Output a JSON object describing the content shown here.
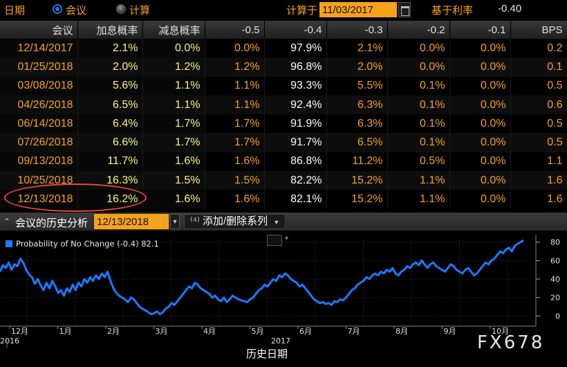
{
  "topbar": {
    "date_label": "日期",
    "mode_meeting": "会议",
    "mode_calc": "计算",
    "calc_label": "计算于",
    "calc_date": "11/03/2017",
    "base_rate_label": "基于利率",
    "base_rate_value": "-0.40"
  },
  "table": {
    "headers": [
      "会议",
      "加息概率",
      "减息概率",
      "-0.5",
      "-0.4",
      "-0.3",
      "-0.2",
      "-0.1",
      "BPS"
    ],
    "rows": [
      [
        "12/14/2017",
        "2.1%",
        "0.0%",
        "0.0%",
        "97.9%",
        "2.1%",
        "0.0%",
        "0.0%",
        "0.2"
      ],
      [
        "01/25/2018",
        "2.0%",
        "1.2%",
        "1.2%",
        "96.8%",
        "2.0%",
        "0.0%",
        "0.0%",
        "0.1"
      ],
      [
        "03/08/2018",
        "5.6%",
        "1.1%",
        "1.1%",
        "93.3%",
        "5.5%",
        "0.1%",
        "0.0%",
        "0.5"
      ],
      [
        "04/26/2018",
        "6.5%",
        "1.1%",
        "1.1%",
        "92.4%",
        "6.3%",
        "0.1%",
        "0.0%",
        "0.6"
      ],
      [
        "06/14/2018",
        "6.4%",
        "1.7%",
        "1.7%",
        "91.9%",
        "6.3%",
        "0.1%",
        "0.0%",
        "0.5"
      ],
      [
        "07/26/2018",
        "6.6%",
        "1.7%",
        "1.7%",
        "91.7%",
        "6.5%",
        "0.1%",
        "0.0%",
        "0.5"
      ],
      [
        "09/13/2018",
        "11.7%",
        "1.6%",
        "1.6%",
        "86.8%",
        "11.2%",
        "0.5%",
        "0.0%",
        "1.1"
      ],
      [
        "10/25/2018",
        "16.3%",
        "1.5%",
        "1.5%",
        "82.2%",
        "15.2%",
        "1.1%",
        "0.0%",
        "1.6"
      ],
      [
        "12/13/2018",
        "16.2%",
        "1.6%",
        "1.6%",
        "82.1%",
        "15.2%",
        "1.1%",
        "0.0%",
        "1.6"
      ]
    ]
  },
  "section": {
    "title": "会议的历史分析",
    "date": "12/13/2018",
    "series_button": "添加/删除系列"
  },
  "colors": {
    "accent_orange": "#f7a21b",
    "value_yellow": "#fff57a",
    "series_blue": "#1a7bff",
    "highlight_red": "#e8473b"
  },
  "watermark": "FX678",
  "chart_data": {
    "type": "line",
    "legend_label": "Probability of No Change (-0.4)",
    "legend_value": "82.1",
    "x_tick_labels": [
      "12月",
      "1月",
      "2月",
      "3月",
      "4月",
      "5月",
      "6月",
      "7月",
      "8月",
      "9月",
      "10月"
    ],
    "year_labels": [
      "2016",
      "2017"
    ],
    "xlabel": "历史日期",
    "ylim": [
      -5,
      85
    ],
    "y_ticks": [
      0,
      20,
      40,
      60,
      80
    ],
    "series": [
      {
        "name": "Probability of No Change (-0.4)",
        "values": [
          48,
          55,
          52,
          58,
          50,
          56,
          54,
          62,
          58,
          50,
          45,
          42,
          35,
          40,
          33,
          28,
          36,
          30,
          38,
          32,
          25,
          28,
          22,
          30,
          26,
          34,
          28,
          36,
          32,
          40,
          36,
          42,
          38,
          44,
          40,
          46,
          42,
          48,
          38,
          30,
          25,
          22,
          20,
          18,
          15,
          20,
          18,
          14,
          10,
          8,
          6,
          4,
          2,
          3,
          5,
          2,
          4,
          8,
          10,
          14,
          12,
          16,
          20,
          24,
          28,
          32,
          30,
          36,
          34,
          30,
          28,
          26,
          24,
          20,
          22,
          18,
          16,
          20,
          15,
          18,
          22,
          20,
          18,
          17,
          16,
          15,
          18,
          20,
          24,
          28,
          30,
          34,
          32,
          36,
          40,
          38,
          44,
          42,
          46,
          44,
          40,
          38,
          36,
          32,
          34,
          30,
          26,
          22,
          18,
          16,
          14,
          15,
          13,
          14,
          12,
          16,
          15,
          18,
          17,
          20,
          24,
          28,
          30,
          34,
          36,
          38,
          42,
          40,
          44,
          46,
          44,
          48,
          46,
          50,
          48,
          52,
          46,
          44,
          48,
          50,
          54,
          52,
          56,
          58,
          55,
          60,
          56,
          52,
          56,
          58,
          54,
          52,
          50,
          48,
          52,
          56,
          54,
          50,
          48,
          46,
          50,
          52,
          48,
          44,
          46,
          50,
          54,
          58,
          56,
          60,
          62,
          66,
          70,
          68,
          72,
          74,
          70,
          76,
          78,
          80,
          82.1
        ]
      }
    ]
  }
}
